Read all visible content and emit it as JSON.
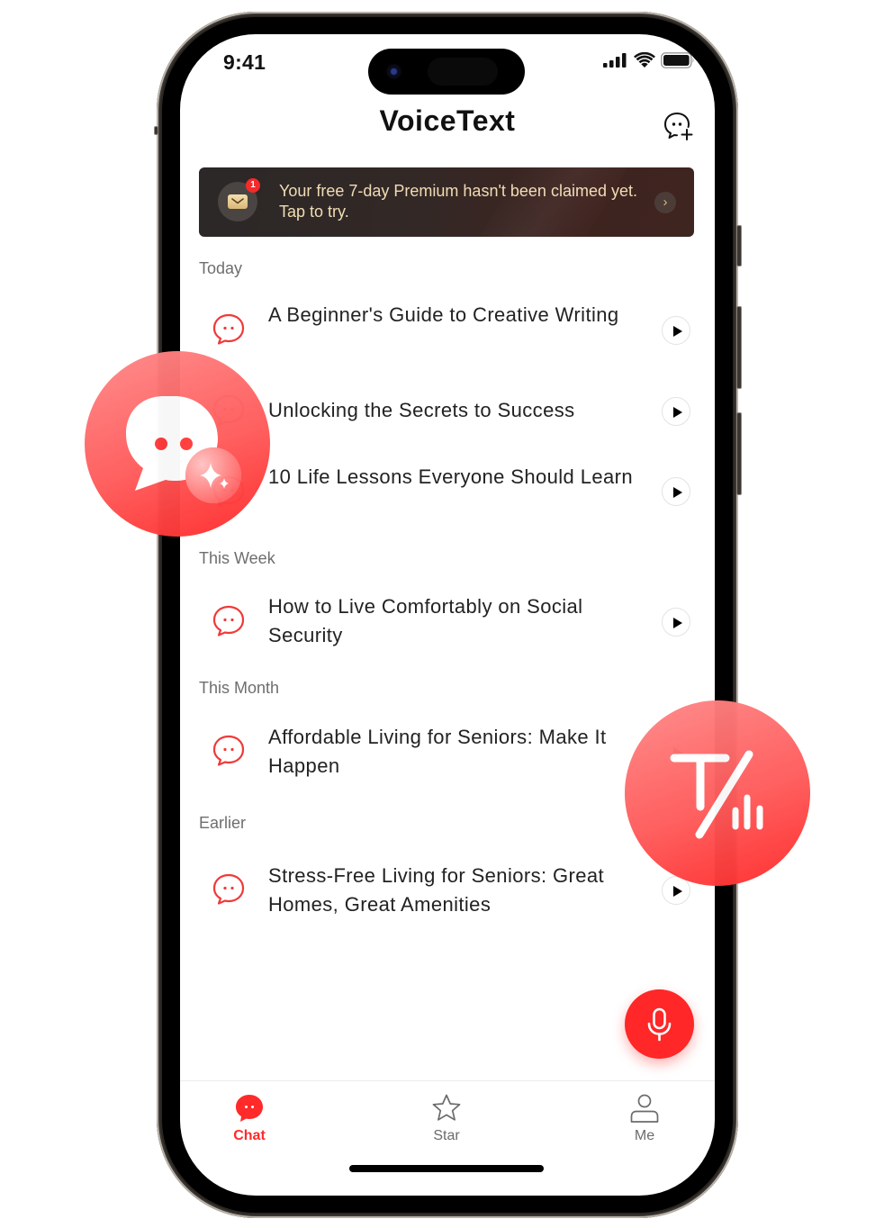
{
  "status_bar": {
    "time": "9:41"
  },
  "header": {
    "title": "VoiceText",
    "new_chat_icon": "new-chat-icon"
  },
  "banner": {
    "text": "Your free 7-day Premium hasn't been claimed yet. Tap to try.",
    "badge_count": "1",
    "icon": "envelope-icon",
    "arrow": "›"
  },
  "sections": [
    {
      "label": "Today",
      "items": [
        {
          "title": "A Beginner's Guide to Creative Writing"
        },
        {
          "title": "Unlocking the Secrets to Success"
        },
        {
          "title": "10 Life Lessons Everyone Should Learn"
        }
      ]
    },
    {
      "label": "This Week",
      "items": [
        {
          "title": "How to Live Comfortably on Social Security"
        }
      ]
    },
    {
      "label": "This Month",
      "items": [
        {
          "title": "Affordable Living for Seniors: Make It Happen"
        }
      ]
    },
    {
      "label": "Earlier",
      "items": [
        {
          "title": "Stress-Free Living for Seniors: Great Homes, Great Amenities"
        }
      ]
    }
  ],
  "tabs": [
    {
      "label": "Chat",
      "icon": "chat-icon",
      "active": true
    },
    {
      "label": "Star",
      "icon": "star-icon",
      "active": false
    },
    {
      "label": "Me",
      "icon": "person-icon",
      "active": false
    }
  ],
  "colors": {
    "accent": "#ff2a2a",
    "banner_text": "#f1dcb4",
    "section_label": "#6e6e6e"
  }
}
